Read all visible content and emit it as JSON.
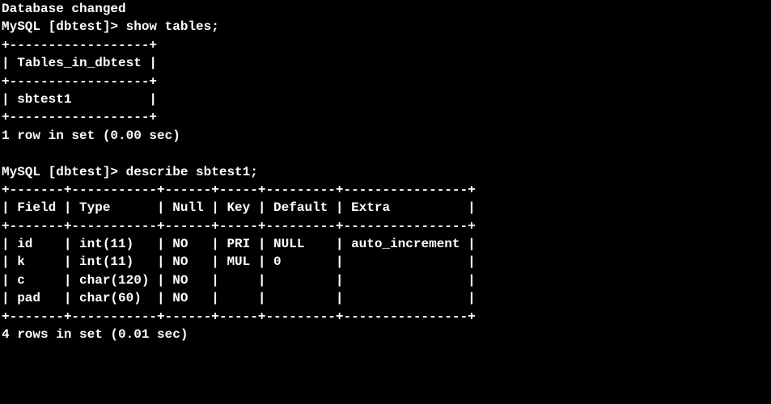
{
  "status_line": "Database changed",
  "prompt": "MySQL [dbtest]> ",
  "cmd1": "show tables;",
  "table1": {
    "top": "+------------------+",
    "header": "| Tables_in_dbtest |",
    "sep": "+------------------+",
    "row1": "| sbtest1          |",
    "bottom": "+------------------+"
  },
  "result1": "1 row in set (0.00 sec)",
  "cmd2": "describe sbtest1;",
  "table2": {
    "top": "+-------+-----------+------+-----+---------+----------------+",
    "header": "| Field | Type      | Null | Key | Default | Extra          |",
    "sep": "+-------+-----------+------+-----+---------+----------------+",
    "row1": "| id    | int(11)   | NO   | PRI | NULL    | auto_increment |",
    "row2": "| k     | int(11)   | NO   | MUL | 0       |                |",
    "row3": "| c     | char(120) | NO   |     |         |                |",
    "row4": "| pad   | char(60)  | NO   |     |         |                |",
    "bottom": "+-------+-----------+------+-----+---------+----------------+"
  },
  "result2": "4 rows in set (0.01 sec)",
  "chart_data": {
    "type": "table",
    "tables_in_dbtest": [
      "sbtest1"
    ],
    "describe_sbtest1": {
      "columns": [
        "Field",
        "Type",
        "Null",
        "Key",
        "Default",
        "Extra"
      ],
      "rows": [
        [
          "id",
          "int(11)",
          "NO",
          "PRI",
          "NULL",
          "auto_increment"
        ],
        [
          "k",
          "int(11)",
          "NO",
          "MUL",
          "0",
          ""
        ],
        [
          "c",
          "char(120)",
          "NO",
          "",
          "",
          ""
        ],
        [
          "pad",
          "char(60)",
          "NO",
          "",
          "",
          ""
        ]
      ]
    }
  }
}
